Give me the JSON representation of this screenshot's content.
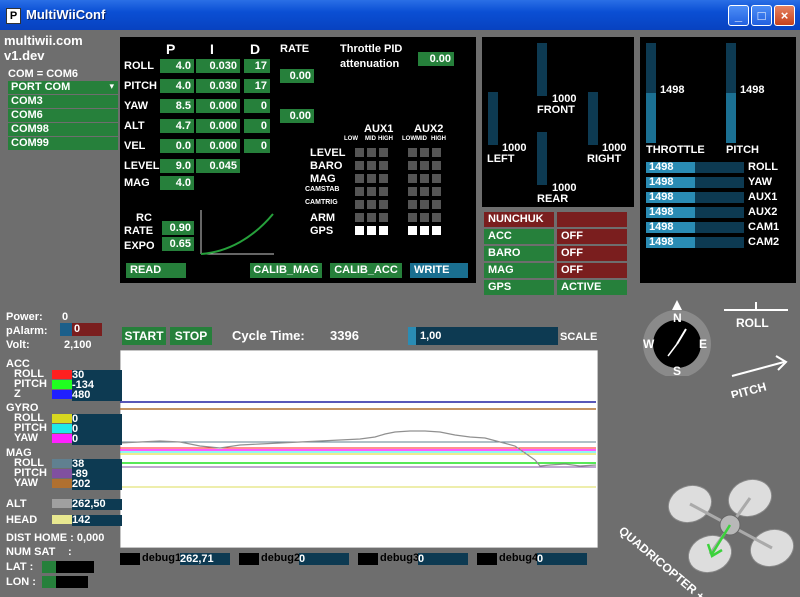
{
  "window": {
    "title": "MultiWiiConf",
    "min": "_",
    "max": "□",
    "close": "×"
  },
  "brand": {
    "name": "multiwii.com",
    "version": "v1.dev"
  },
  "com": {
    "current": "COM = COM6",
    "port_label": "PORT COM",
    "ports": [
      "COM3",
      "COM6",
      "COM98",
      "COM99"
    ]
  },
  "pid": {
    "headers": {
      "p": "P",
      "i": "I",
      "d": "D",
      "rate": "RATE"
    },
    "rows": [
      {
        "name": "ROLL",
        "p": "4.0",
        "i": "0.030",
        "d": "17",
        "rate": "0.00"
      },
      {
        "name": "PITCH",
        "p": "4.0",
        "i": "0.030",
        "d": "17",
        "rate": ""
      },
      {
        "name": "YAW",
        "p": "8.5",
        "i": "0.000",
        "d": "0",
        "rate": "0.00"
      },
      {
        "name": "ALT",
        "p": "4.7",
        "i": "0.000",
        "d": "0",
        "rate": ""
      },
      {
        "name": "VEL",
        "p": "0.0",
        "i": "0.000",
        "d": "0",
        "rate": ""
      },
      {
        "name": "LEVEL",
        "p": "9.0",
        "i": "0.045",
        "d": "",
        "rate": ""
      },
      {
        "name": "MAG",
        "p": "4.0",
        "i": "",
        "d": "",
        "rate": ""
      }
    ],
    "throttle_pid": {
      "label1": "Throttle PID",
      "label2": "attenuation",
      "value": "0.00"
    },
    "rc": {
      "label": "RC",
      "rate_label": "RATE",
      "rate": "0.90",
      "expo_label": "EXPO",
      "expo": "0.65"
    },
    "buttons": {
      "read": "READ",
      "calib_mag": "CALIB_MAG",
      "calib_acc": "CALIB_ACC",
      "write": "WRITE"
    }
  },
  "aux": {
    "aux1": "AUX1",
    "aux2": "AUX2",
    "levels": [
      "LOW",
      "MID",
      "HIGH",
      "LOW",
      "MID",
      "HIGH"
    ],
    "rows": [
      "LEVEL",
      "BARO",
      "MAG",
      "CAMSTAB",
      "CAMTRIG",
      "ARM",
      "GPS"
    ],
    "states": [
      [
        0,
        0,
        0,
        0,
        0,
        0
      ],
      [
        0,
        0,
        0,
        0,
        0,
        0
      ],
      [
        0,
        0,
        0,
        0,
        0,
        0
      ],
      [
        0,
        0,
        0,
        0,
        0,
        0
      ],
      [
        0,
        0,
        0,
        0,
        0,
        0
      ],
      [
        0,
        0,
        0,
        0,
        0,
        0
      ],
      [
        1,
        1,
        1,
        1,
        1,
        1
      ]
    ]
  },
  "motors": {
    "front": "FRONT",
    "front_val": "1000",
    "left": "LEFT",
    "left_val": "1000",
    "right": "RIGHT",
    "right_val": "1000",
    "rear": "REAR",
    "rear_val": "1000",
    "front_level": 0.0,
    "left_level": 0.0,
    "right_level": 0.0,
    "rear_level": 0.0
  },
  "sensors_status": [
    {
      "name": "NUNCHUK",
      "state": "",
      "name_color": "#7a1e1e",
      "state_color": "#7a1e1e"
    },
    {
      "name": "ACC",
      "state": "OFF",
      "name_color": "#26803b",
      "state_color": "#7a1e1e"
    },
    {
      "name": "BARO",
      "state": "OFF",
      "name_color": "#26803b",
      "state_color": "#7a1e1e"
    },
    {
      "name": "MAG",
      "state": "OFF",
      "name_color": "#26803b",
      "state_color": "#7a1e1e"
    },
    {
      "name": "GPS",
      "state": "ACTIVE",
      "name_color": "#26803b",
      "state_color": "#26803b"
    }
  ],
  "rc_channels": {
    "throttle": {
      "label": "THROTTLE",
      "value": "1498"
    },
    "pitch": {
      "label": "PITCH",
      "value": "1498"
    },
    "throttle_level": 0.5,
    "pitch_level": 0.5,
    "rows": [
      {
        "name": "ROLL",
        "value": "1498"
      },
      {
        "name": "YAW",
        "value": "1498"
      },
      {
        "name": "AUX1",
        "value": "1498"
      },
      {
        "name": "AUX2",
        "value": "1498"
      },
      {
        "name": "CAM1",
        "value": "1498"
      },
      {
        "name": "CAM2",
        "value": "1498"
      }
    ]
  },
  "status": {
    "power_label": "Power:",
    "power": "0",
    "palarm_label": "pAlarm:",
    "palarm": "0",
    "volt_label": "Volt:",
    "volt": "2,100"
  },
  "graph_controls": {
    "start": "START",
    "stop": "STOP",
    "cycle_label": "Cycle Time:",
    "cycle": "3396",
    "scale_value": "1,00",
    "scale_label": "SCALE"
  },
  "sensors": {
    "acc": {
      "label": "ACC",
      "rows": [
        {
          "name": "ROLL",
          "value": "30",
          "color": "#ff2020"
        },
        {
          "name": "PITCH",
          "value": "-134",
          "color": "#20ff20"
        },
        {
          "name": "Z",
          "value": "480",
          "color": "#2020ff"
        }
      ]
    },
    "gyro": {
      "label": "GYRO",
      "rows": [
        {
          "name": "ROLL",
          "value": "0",
          "color": "#d8d820"
        },
        {
          "name": "PITCH",
          "value": "0",
          "color": "#20e8e8"
        },
        {
          "name": "YAW",
          "value": "0",
          "color": "#ff20ff"
        }
      ]
    },
    "mag": {
      "label": "MAG",
      "rows": [
        {
          "name": "ROLL",
          "value": "38",
          "color": "#608090"
        },
        {
          "name": "PITCH",
          "value": "-89",
          "color": "#8050a0"
        },
        {
          "name": "YAW",
          "value": "202",
          "color": "#b07030"
        }
      ]
    },
    "alt": {
      "label": "ALT",
      "value": "262,50",
      "color": "#a0a0a0"
    },
    "head": {
      "label": "HEAD",
      "value": "142",
      "color": "#e8e890"
    }
  },
  "gps": {
    "dist_home": "DIST HOME : 0,000",
    "num_sat": "NUM SAT",
    "num_sat_sep": ":",
    "lat": "LAT :",
    "lon": "LON :"
  },
  "debug": [
    {
      "label": "debug1",
      "value": "262,71"
    },
    {
      "label": "debug2",
      "value": "0"
    },
    {
      "label": "debug3",
      "value": "0"
    },
    {
      "label": "debug4",
      "value": "0"
    }
  ],
  "compass": {
    "n": "N",
    "s": "S",
    "e": "E",
    "w": "W"
  },
  "attitude": {
    "roll": "ROLL",
    "pitch": "PITCH",
    "model": "QUADRICOPTER +"
  }
}
